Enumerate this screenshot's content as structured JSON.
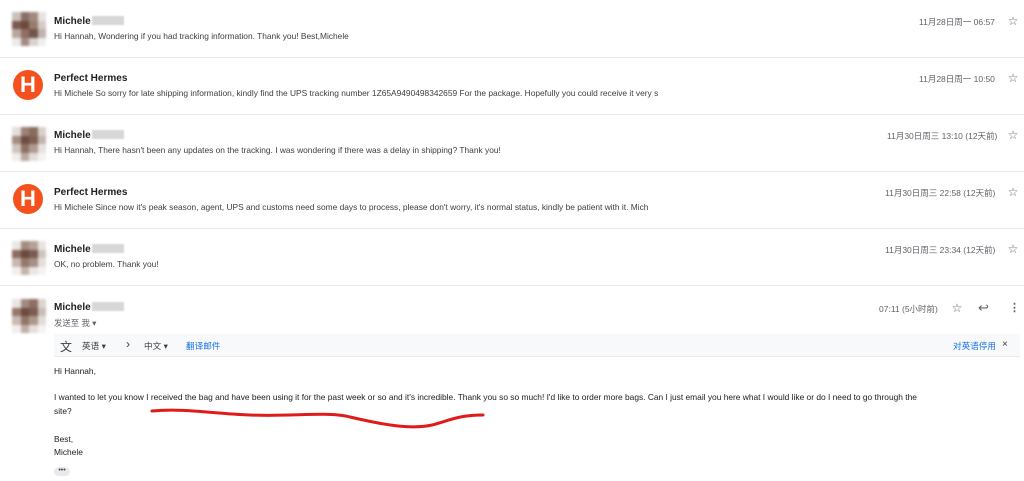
{
  "messages": [
    {
      "sender": "Michele",
      "snippet": "Hi Hannah, Wondering if you had tracking information. Thank you! Best,Michele",
      "date": "11月28日周一 06:57",
      "avatar": "blurred"
    },
    {
      "sender": "Perfect Hermes",
      "snippet": "Hi Michele So sorry for late shipping information, kindly find the UPS tracking number 1Z65A9490498342659 For the package. Hopefully you could receive it very s",
      "date": "11月28日周一 10:50",
      "avatar_letter": "H"
    },
    {
      "sender": "Michele",
      "snippet": "Hi Hannah, There hasn't been any updates on the tracking. I was wondering if there was a delay in shipping? Thank you!",
      "date": "11月30日周三 13:10 (12天前)",
      "avatar": "blurred"
    },
    {
      "sender": "Perfect Hermes",
      "snippet": "Hi Michele Since now it's peak season, agent, UPS and customs need some days to process, please don't worry, it's normal status, kindly be patient with it. Mich",
      "date": "11月30日周三 22:58 (12天前)",
      "avatar_letter": "H"
    },
    {
      "sender": "Michele",
      "snippet": "OK, no problem. Thank you!",
      "date": "11月30日周三 23:34 (12天前)",
      "avatar": "blurred"
    }
  ],
  "open_message": {
    "sender": "Michele",
    "sent_to": "发送至 我 ▾",
    "date": "07:11 (5小时前)",
    "translation_bar": {
      "source_lang": "英语 ▾",
      "arrow": "›",
      "target_lang": "中文 ▾",
      "translate_link": "翻译邮件",
      "disable_link": "对英语停用",
      "close": "×"
    },
    "body": {
      "greeting": "Hi Hannah,",
      "paragraph": "I wanted to let you know I received the bag and have been using it for the past week or so and it's incredible. Thank you so so much! I'd like to order more bags. Can I just email you here what I would like or do I need to go through the",
      "paragraph_cont": "site?",
      "closing": "Best,",
      "signature": "Michele",
      "ellipsis": "•••"
    }
  },
  "icons": {
    "star": "star-icon",
    "reply": "reply-icon",
    "more": "more-vert-icon",
    "translate": "translate-icon"
  },
  "colors": {
    "hermes_avatar": "#f4511e",
    "link": "#1a73e8",
    "annotation": "#e01b1b"
  }
}
